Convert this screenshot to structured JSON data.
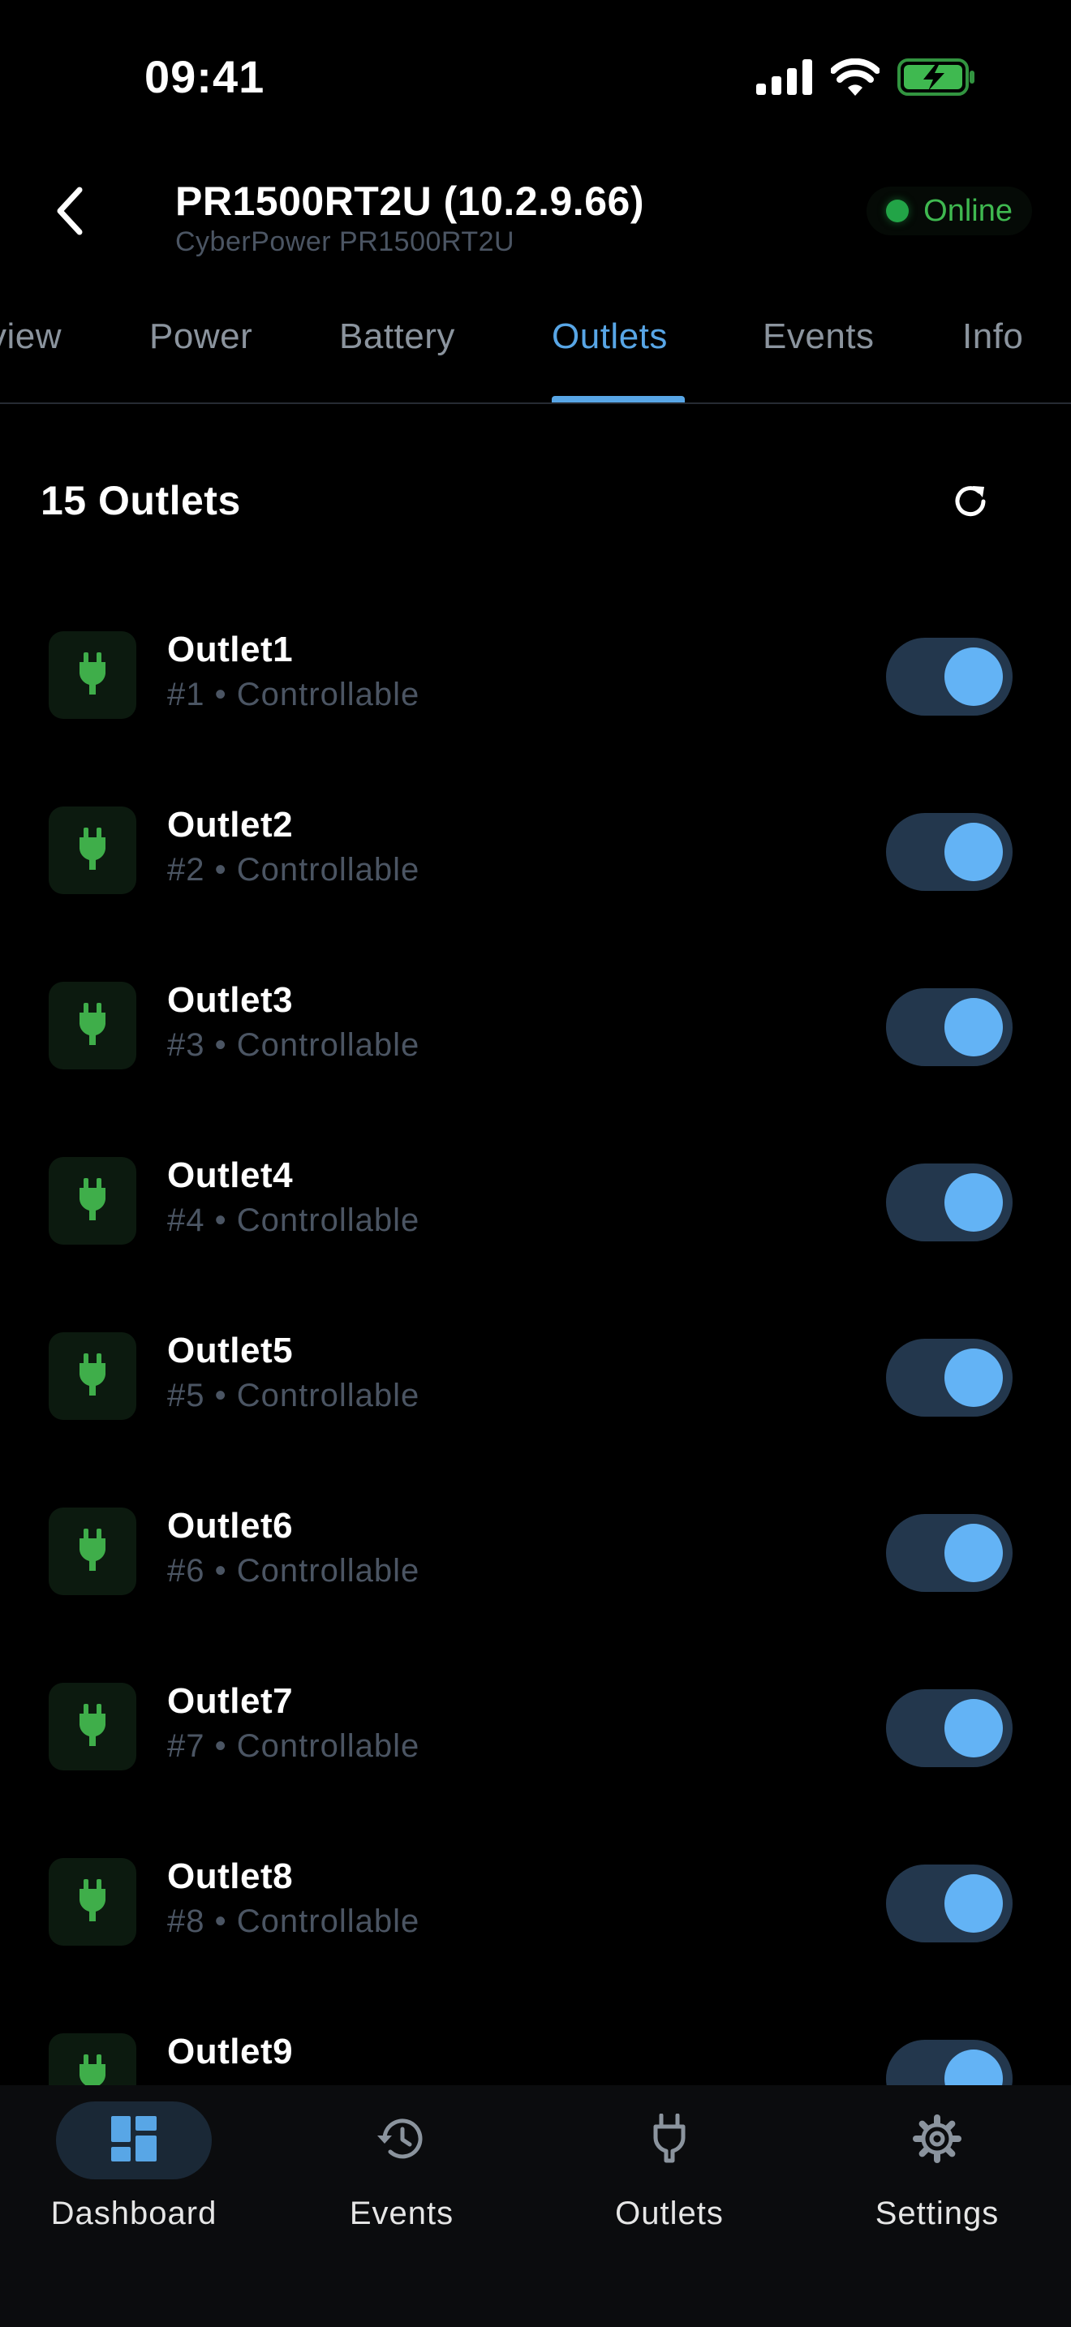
{
  "status_bar": {
    "time": "09:41"
  },
  "header": {
    "title": "PR1500RT2U (10.2.9.66)",
    "subtitle": "CyberPower PR1500RT2U",
    "status": "Online"
  },
  "tabs": [
    {
      "label": "view",
      "active": false
    },
    {
      "label": "Power",
      "active": false
    },
    {
      "label": "Battery",
      "active": false
    },
    {
      "label": "Outlets",
      "active": true
    },
    {
      "label": "Events",
      "active": false
    },
    {
      "label": "Info",
      "active": false
    }
  ],
  "section": {
    "title": "15 Outlets"
  },
  "outlets": [
    {
      "name": "Outlet1",
      "number": "#1",
      "separator": "•",
      "mode": "Controllable",
      "on": true
    },
    {
      "name": "Outlet2",
      "number": "#2",
      "separator": "•",
      "mode": "Controllable",
      "on": true
    },
    {
      "name": "Outlet3",
      "number": "#3",
      "separator": "•",
      "mode": "Controllable",
      "on": true
    },
    {
      "name": "Outlet4",
      "number": "#4",
      "separator": "•",
      "mode": "Controllable",
      "on": true
    },
    {
      "name": "Outlet5",
      "number": "#5",
      "separator": "•",
      "mode": "Controllable",
      "on": true
    },
    {
      "name": "Outlet6",
      "number": "#6",
      "separator": "•",
      "mode": "Controllable",
      "on": true
    },
    {
      "name": "Outlet7",
      "number": "#7",
      "separator": "•",
      "mode": "Controllable",
      "on": true
    },
    {
      "name": "Outlet8",
      "number": "#8",
      "separator": "•",
      "mode": "Controllable",
      "on": true
    },
    {
      "name": "Outlet9",
      "number": "",
      "separator": "",
      "mode": "",
      "on": true
    }
  ],
  "bottom_nav": [
    {
      "label": "Dashboard",
      "icon": "dashboard-icon",
      "active": true
    },
    {
      "label": "Events",
      "icon": "history-icon",
      "active": false
    },
    {
      "label": "Outlets",
      "icon": "plug-icon",
      "active": false
    },
    {
      "label": "Settings",
      "icon": "gear-icon",
      "active": false
    }
  ],
  "colors": {
    "background": "#000000",
    "accent": "#58a6e6",
    "online": "#3fb950",
    "outlet_icon": "#3fae4a",
    "toggle_track": "#23374d",
    "toggle_knob": "#63b3f5"
  }
}
